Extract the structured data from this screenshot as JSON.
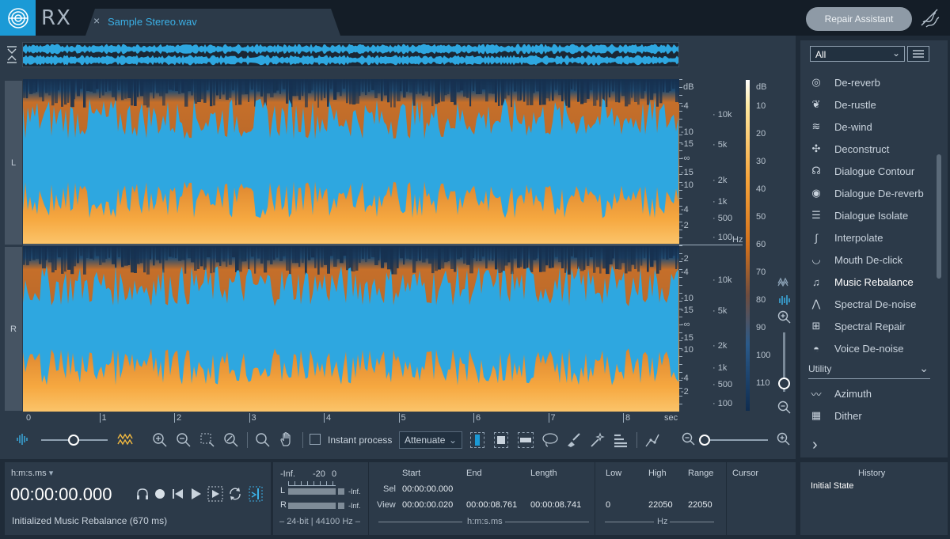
{
  "app": {
    "name": "RX"
  },
  "file_tab": {
    "title": "Sample Stereo.wav",
    "close_glyph": "×"
  },
  "header": {
    "repair_assistant": "Repair Assistant"
  },
  "channels": {
    "left": "L",
    "right": "R"
  },
  "scales": {
    "db_label": "dB",
    "hz_label": "Hz",
    "left_db_ticks": [
      "-4",
      "-10",
      "-15",
      "-∞",
      "-15",
      "-10",
      "-4",
      "-2"
    ],
    "right_db_ticks": [
      "-2",
      "-4",
      "-10",
      "-15",
      "-∞",
      "-15",
      "-10",
      "-4",
      "-2"
    ],
    "left_hz_ticks": [
      "10k",
      "5k",
      "2k",
      "1k",
      "500",
      "100"
    ],
    "right_hz_ticks": [
      "10k",
      "5k",
      "2k",
      "1k",
      "500",
      "100"
    ],
    "colorbar_ticks": [
      "10",
      "20",
      "30",
      "40",
      "50",
      "60",
      "70",
      "80",
      "90",
      "100",
      "110"
    ]
  },
  "time_ruler": {
    "ticks": [
      "0",
      "1",
      "2",
      "3",
      "4",
      "5",
      "6",
      "7",
      "8"
    ],
    "unit": "sec"
  },
  "toolbar": {
    "instant_process": "Instant process",
    "attenuate": "Attenuate",
    "icons": [
      "waveform-icon",
      "zoom-slider",
      "spectrogram-icon",
      "zoom-in-icon",
      "zoom-out-icon",
      "zoom-selection-icon",
      "zoom-fit-icon",
      "magnify-icon",
      "hand-icon",
      "time-select-icon",
      "freq-select-icon",
      "rect-select-icon",
      "lasso-icon",
      "brush-icon",
      "magic-wand-icon",
      "harmonic-select-icon",
      "pencil-icon",
      "zoom-out-freq-icon",
      "zoom-in-freq-icon"
    ]
  },
  "transport": {
    "format": "h:m:s.ms",
    "time": "00:00:00.000",
    "status": "Initialized Music Rebalance (670 ms)"
  },
  "meters": {
    "inf": "-Inf.",
    "minus20": "-20",
    "zero": "0",
    "l": "L",
    "r": "R",
    "l_inf": "-Inf.",
    "r_inf": "-Inf.",
    "format": "24-bit | 44100 Hz"
  },
  "selection": {
    "start": "Start",
    "end": "End",
    "length": "Length",
    "sel": "Sel",
    "view": "View",
    "sel_start": "00:00:00.000",
    "view_start": "00:00:00.020",
    "view_end": "00:00:08.761",
    "view_length": "00:00:08.741",
    "unit": "h:m:s.ms"
  },
  "frequency": {
    "low": "Low",
    "high": "High",
    "range": "Range",
    "low_val": "0",
    "high_val": "22050",
    "range_val": "22050",
    "unit": "Hz"
  },
  "cursor": {
    "label": "Cursor"
  },
  "history": {
    "title": "History",
    "state": "Initial State"
  },
  "modules": {
    "filter": "All",
    "items": [
      {
        "label": "De-reverb",
        "icon": "de-reverb-icon"
      },
      {
        "label": "De-rustle",
        "icon": "de-rustle-icon"
      },
      {
        "label": "De-wind",
        "icon": "de-wind-icon"
      },
      {
        "label": "Deconstruct",
        "icon": "deconstruct-icon"
      },
      {
        "label": "Dialogue Contour",
        "icon": "dialogue-contour-icon"
      },
      {
        "label": "Dialogue De-reverb",
        "icon": "dialogue-de-reverb-icon"
      },
      {
        "label": "Dialogue Isolate",
        "icon": "dialogue-isolate-icon"
      },
      {
        "label": "Interpolate",
        "icon": "interpolate-icon"
      },
      {
        "label": "Mouth De-click",
        "icon": "mouth-de-click-icon"
      },
      {
        "label": "Music Rebalance",
        "icon": "music-rebalance-icon"
      },
      {
        "label": "Spectral De-noise",
        "icon": "spectral-de-noise-icon"
      },
      {
        "label": "Spectral Repair",
        "icon": "spectral-repair-icon"
      },
      {
        "label": "Voice De-noise",
        "icon": "voice-de-noise-icon"
      }
    ],
    "utility": "Utility",
    "utility_items": [
      {
        "label": "Azimuth",
        "icon": "azimuth-icon"
      },
      {
        "label": "Dither",
        "icon": "dither-icon"
      }
    ],
    "more": "›"
  },
  "colors": {
    "accent": "#1b9ad6",
    "wave": "#2ea7e0",
    "spec_hot": "#f4a43b",
    "spec_cold": "#15304f"
  }
}
